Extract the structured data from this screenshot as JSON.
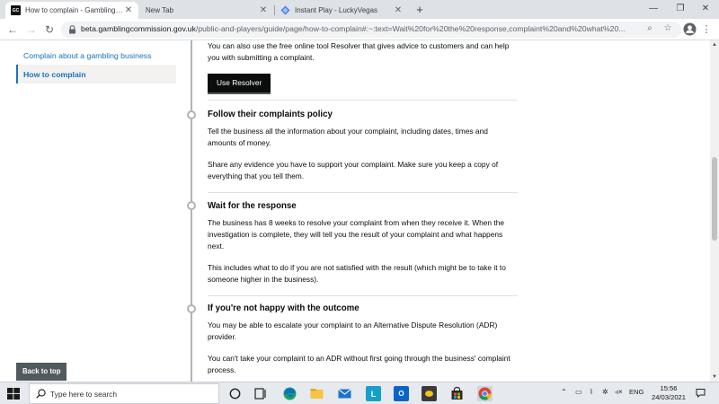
{
  "browser": {
    "tabs": [
      {
        "title": "How to complain - Gambling Co",
        "favicon": "GC",
        "active": true
      },
      {
        "title": "New Tab",
        "active": false
      },
      {
        "title": "Instant Play - LuckyVegas",
        "active": false
      }
    ],
    "new_tab": "+",
    "window_controls": {
      "minimize": "—",
      "maximize": "❐",
      "close": "✕"
    },
    "url_host": "beta.gamblingcommission.gov.uk",
    "url_path": "/public-and-players/guide/page/how-to-complain#:~:text=Wait%20for%20the%20response,complaint%20and%20what%20..."
  },
  "sidebar": {
    "items": [
      {
        "label": "Complain about a gambling business"
      },
      {
        "label": "How to complain"
      }
    ]
  },
  "main": {
    "intro_text": "You can also use the free online tool Resolver that gives advice to customers and can help you with submitting a complaint.",
    "resolver_button": "Use Resolver",
    "sections": [
      {
        "title": "Follow their complaints policy",
        "paragraphs": [
          "Tell the business all the information about your complaint, including dates, times and amounts of money.",
          "Share any evidence you have to support your complaint. Make sure you keep a copy of everything that you tell them."
        ]
      },
      {
        "title": "Wait for the response",
        "paragraphs": [
          "The business has 8 weeks to resolve your complaint from when they receive it. When the investigation is complete, they will tell you the result of your complaint and what happens next.",
          "This includes what to do if you are not satisfied with the result (which might be to take it to someone higher in the business)."
        ]
      },
      {
        "title": "If you're not happy with the outcome",
        "paragraphs": [
          "You may be able to escalate your complaint to an Alternative Dispute Resolution (ADR) provider.",
          "You can't take your complaint to an ADR without first going through the business' complaint process."
        ]
      }
    ],
    "back_to_top": "Back to top"
  },
  "taskbar": {
    "search_placeholder": "Type here to search",
    "language": "ENG",
    "time": "15:56",
    "date": "24/03/2021"
  },
  "colors": {
    "link": "#1d70b8",
    "text": "#0b0c0c",
    "button": "#0b0c0c",
    "back_to_top": "#505a5f"
  }
}
